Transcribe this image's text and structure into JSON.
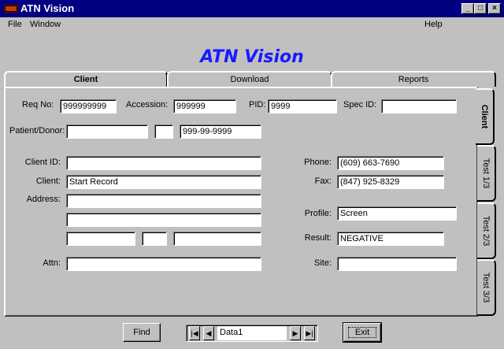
{
  "window": {
    "title": "ATN Vision",
    "controls": [
      "minimize-icon",
      "maximize-icon",
      "close-icon"
    ]
  },
  "menu": {
    "file": "File",
    "window": "Window",
    "help": "Help"
  },
  "heading": "ATN Vision",
  "tabs": {
    "client": "Client",
    "download": "Download",
    "reports": "Reports"
  },
  "side_tabs": {
    "client": "Client",
    "test1": "Test 1/3",
    "test2": "Test 2/3",
    "test3": "Test 3/3"
  },
  "form": {
    "req_no": {
      "label": "Req No:",
      "value": "999999999"
    },
    "accession": {
      "label": "Accession:",
      "value": "999999"
    },
    "pid": {
      "label": "PID:",
      "value": "9999"
    },
    "spec_id": {
      "label": "Spec ID:",
      "value": ""
    },
    "patient": {
      "label": "Patient/Donor:",
      "last": "",
      "mi": "",
      "ssn": "999-99-9999"
    },
    "client_id": {
      "label": "Client ID:",
      "value": ""
    },
    "client": {
      "label": "Client:",
      "value": "Start Record"
    },
    "address": {
      "label": "Address:",
      "line1": "",
      "line2": "",
      "city": "",
      "state": "",
      "zip": ""
    },
    "attn": {
      "label": "Attn:",
      "value": ""
    },
    "phone": {
      "label": "Phone:",
      "value": "(609) 663-7690"
    },
    "fax": {
      "label": "Fax:",
      "value": "(847) 925-8329"
    },
    "profile": {
      "label": "Profile:",
      "value": "Screen"
    },
    "result": {
      "label": "Result:",
      "value": "NEGATIVE"
    },
    "site": {
      "label": "Site:",
      "value": ""
    }
  },
  "footer": {
    "find": "Find",
    "exit": "Exit",
    "navigator": {
      "value": "Data1",
      "first": "first-record-icon",
      "prev": "prev-record-icon",
      "next": "next-record-icon",
      "last": "last-record-icon"
    }
  },
  "colors": {
    "titlebar": "#000080",
    "heading": "#1a1aff",
    "face": "#c0c0c0"
  }
}
